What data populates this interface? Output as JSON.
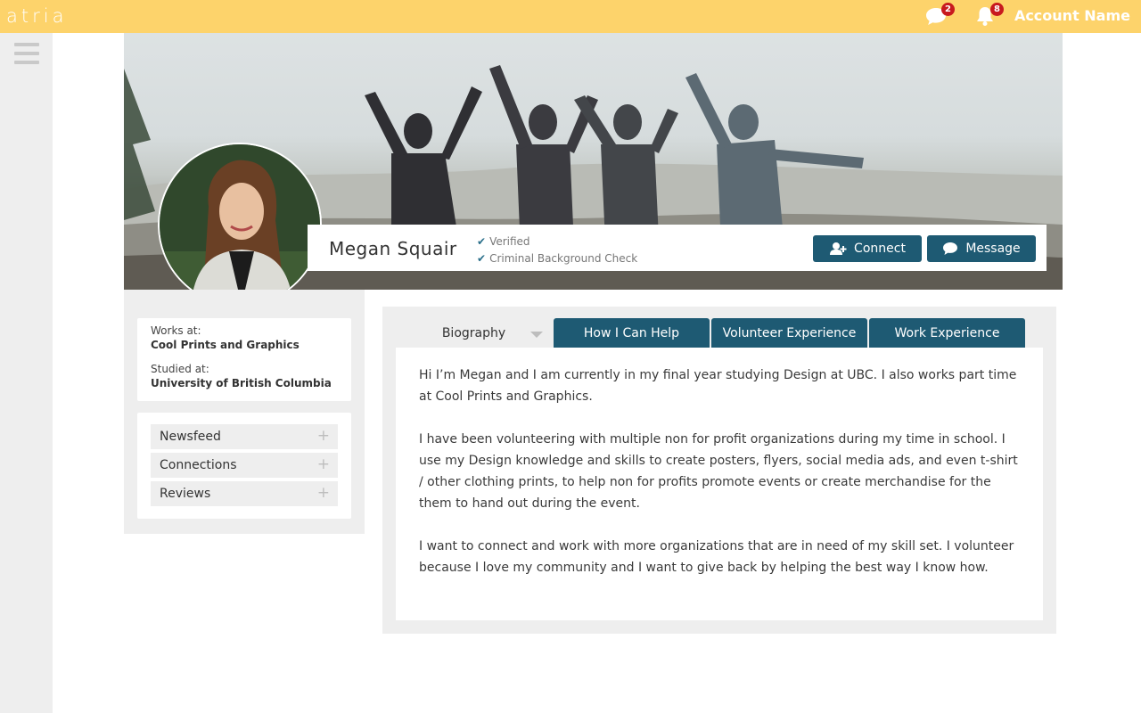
{
  "app": {
    "logo": "atria",
    "account_name": "Account Name",
    "messages_count": "2",
    "notifications_count": "8"
  },
  "profile": {
    "name": "Megan Squair",
    "badges": [
      "Verified",
      "Criminal Background Check"
    ],
    "connect_label": "Connect",
    "message_label": "Message"
  },
  "info": {
    "works_label": "Works at:",
    "works_value": "Cool Prints and Graphics",
    "studied_label": "Studied at:",
    "studied_value": "University of British Columbia"
  },
  "nav": [
    {
      "label": "Newsfeed"
    },
    {
      "label": "Connections"
    },
    {
      "label": "Reviews"
    }
  ],
  "tabs": [
    "Biography",
    "How I Can Help",
    "Volunteer Experience",
    "Work Experience"
  ],
  "biography": [
    "Hi I’m Megan and I am currently in my final year studying Design at UBC. I also works part time at Cool Prints and Graphics.",
    "I have been volunteering with multiple non for profit organizations during my time in school. I use my Design knowledge and skills to create posters, flyers, social media ads, and even t-shirt / other clothing prints, to help non for profits promote events or create merchandise for the them to hand out during the event.",
    "I want to connect and work with more organizations that are in need of my skill set. I volunteer because I love my community and I want to give back by helping the best way I know how."
  ],
  "colors": {
    "topbar": "#fdd36b",
    "accent": "#1e5a73",
    "badge": "#c8191e",
    "panel": "#eeeeee"
  }
}
